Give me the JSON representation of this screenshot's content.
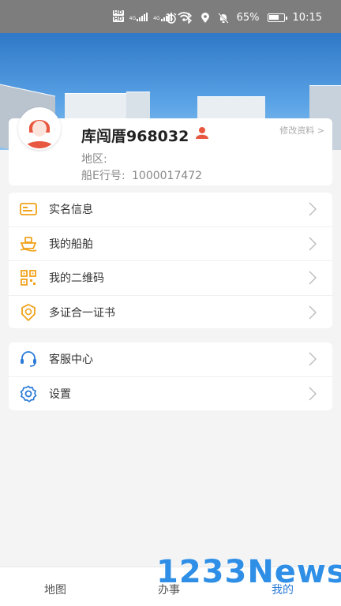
{
  "status_bar": {
    "network_badge_1": "HD",
    "network_badge_2": "HD",
    "network_type_1": "4G",
    "network_type_2": "4G",
    "battery_percent": "65%",
    "time": "10:15"
  },
  "profile": {
    "name": "库闯厝968032",
    "edit_label": "修改资料 >",
    "region_label": "地区:",
    "id_label": "船E行号:",
    "id_value": "1000017472"
  },
  "menu_primary": [
    {
      "label": "实名信息",
      "icon": "id-card-icon"
    },
    {
      "label": "我的船舶",
      "icon": "ship-icon"
    },
    {
      "label": "我的二维码",
      "icon": "qr-code-icon"
    },
    {
      "label": "多证合一证书",
      "icon": "certificate-icon"
    }
  ],
  "menu_secondary": [
    {
      "label": "客服中心",
      "icon": "headset-icon"
    },
    {
      "label": "设置",
      "icon": "gear-icon"
    }
  ],
  "bottom_nav": {
    "tabs": [
      {
        "label": "地图",
        "active": false
      },
      {
        "label": "办事",
        "active": false
      },
      {
        "label": "我的",
        "active": true
      }
    ]
  },
  "watermark": "1233News",
  "colors": {
    "accent": "#2b7bd8",
    "icon_orange": "#f0a21a",
    "avatar_red": "#e8573f"
  }
}
